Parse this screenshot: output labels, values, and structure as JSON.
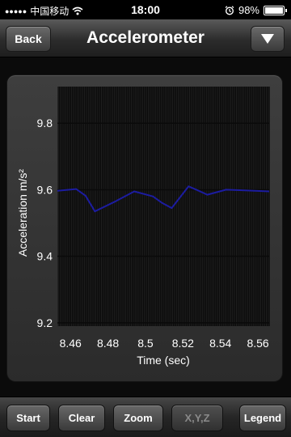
{
  "status_bar": {
    "carrier": "中国移动",
    "time": "18:00",
    "battery": "98%",
    "battery_level": 0.98,
    "signal_icon": "signal-dots-icon",
    "wifi_icon": "wifi-icon",
    "alarm_icon": "alarm-clock-icon"
  },
  "nav": {
    "back_label": "Back",
    "title": "Accelerometer",
    "menu_icon": "triangle-down-icon"
  },
  "chart_data": {
    "type": "line",
    "title": "",
    "xlabel": "Time (sec)",
    "ylabel": "Acceleration m/s²",
    "xlim": [
      8.453,
      8.566
    ],
    "ylim": [
      9.19,
      9.91
    ],
    "x_ticks": [
      8.46,
      8.48,
      8.5,
      8.52,
      8.54,
      8.56
    ],
    "x_tick_labels": [
      "8.46",
      "8.48",
      "8.5",
      "8.52",
      "8.54",
      "8.56"
    ],
    "y_ticks": [
      9.2,
      9.4,
      9.6,
      9.8
    ],
    "y_tick_labels": [
      "9.2",
      "9.4",
      "9.6",
      "9.8"
    ],
    "grid": true,
    "series": [
      {
        "color": "#1c1ca0",
        "x": [
          8.453,
          8.463,
          8.468,
          8.473,
          8.484,
          8.494,
          8.504,
          8.509,
          8.514,
          8.523,
          8.528,
          8.533,
          8.543,
          8.553,
          8.566
        ],
        "y": [
          9.597,
          9.602,
          9.582,
          9.535,
          9.565,
          9.595,
          9.58,
          9.56,
          9.545,
          9.61,
          9.598,
          9.585,
          9.6,
          9.598,
          9.595
        ]
      }
    ]
  },
  "toolbar": {
    "start": "Start",
    "clear": "Clear",
    "zoom": "Zoom",
    "xyz": "X,Y,Z",
    "legend": "Legend"
  }
}
